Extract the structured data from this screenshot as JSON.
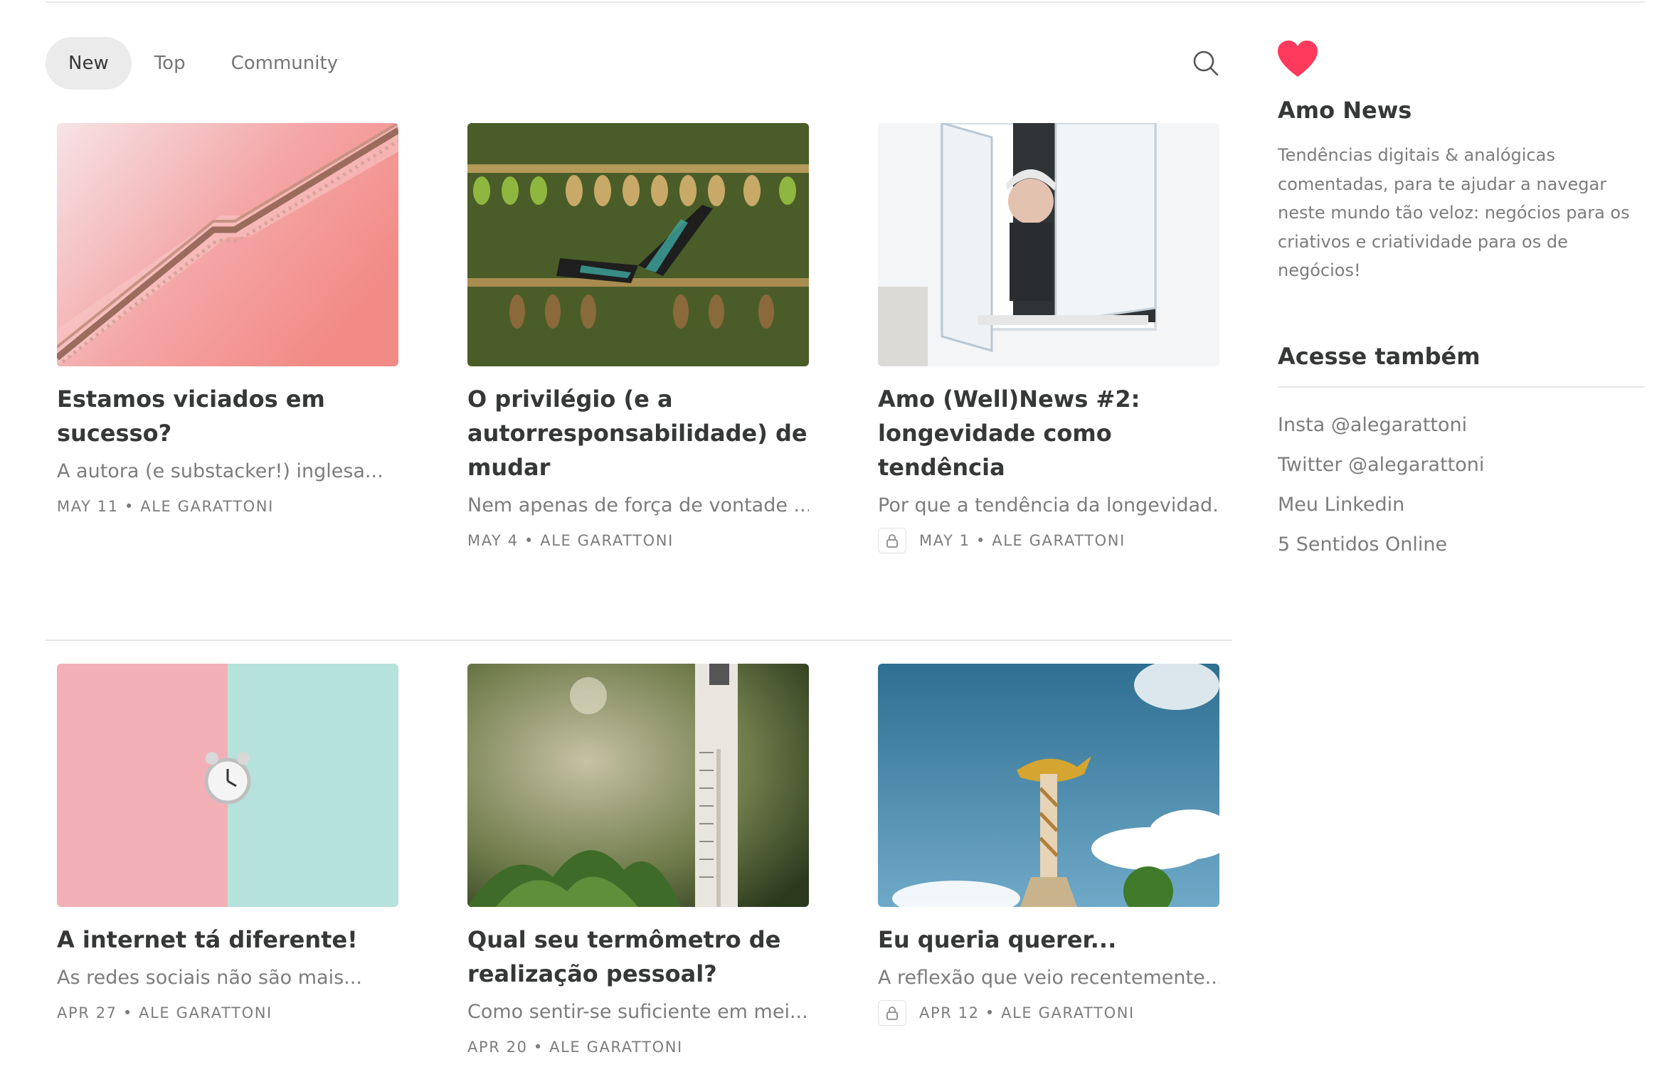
{
  "nav": {
    "tabs": [
      {
        "label": "New",
        "active": true
      },
      {
        "label": "Top",
        "active": false
      },
      {
        "label": "Community",
        "active": false
      }
    ],
    "search_icon": "search-icon"
  },
  "posts": [
    {
      "title": "Estamos viciados em sucesso?",
      "subtitle": "A autora (e substacker!) inglesa...",
      "date": "MAY 11",
      "author": "ALE GARATTONI",
      "locked": false,
      "image": "pink escalator on salmon wall"
    },
    {
      "title": "O privilégio (e a autorresponsabilidade) de mudar",
      "subtitle": "Nem apenas de força de vontade ...",
      "date": "MAY 4",
      "author": "ALE GARATTONI",
      "locked": false,
      "image": "butterfly among chrysalises"
    },
    {
      "title": "Amo (Well)News #2: longevidade como tendência",
      "subtitle": "Por que a tendência da longevidad...",
      "date": "MAY 1",
      "author": "ALE GARATTONI",
      "locked": true,
      "image": "elderly woman smiling at window"
    },
    {
      "title": "A internet tá diferente!",
      "subtitle": "As redes sociais não são mais...",
      "date": "APR 27",
      "author": "ALE GARATTONI",
      "locked": false,
      "image": "alarm clock on pink and mint wall"
    },
    {
      "title": "Qual seu termômetro de realização pessoal?",
      "subtitle": "Como sentir-se suficiente em mei...",
      "date": "APR 20",
      "author": "ALE GARATTONI",
      "locked": false,
      "image": "thermometer in garden"
    },
    {
      "title": "Eu queria querer...",
      "subtitle": "A reflexão que veio recentemente...",
      "date": "APR 12",
      "author": "ALE GARATTONI",
      "locked": true,
      "image": "golden genie lamp on pillar under blue sky"
    }
  ],
  "sidebar": {
    "icon": "heart-icon",
    "publication_name": "Amo News",
    "description": "Tendências digitais & analógicas comentadas, para te ajudar a navegar neste mundo tão veloz: negócios para os criativos e criatividade para os de negócios!",
    "links_heading": "Acesse também",
    "links": [
      "Insta @alegarattoni",
      "Twitter @alegarattoni",
      "Meu Linkedin",
      "5 Sentidos Online"
    ]
  },
  "colors": {
    "accent": "#ff3a5c",
    "text": "#363737",
    "muted": "#7c7c7c",
    "tab_active_bg": "#ebebeb"
  }
}
